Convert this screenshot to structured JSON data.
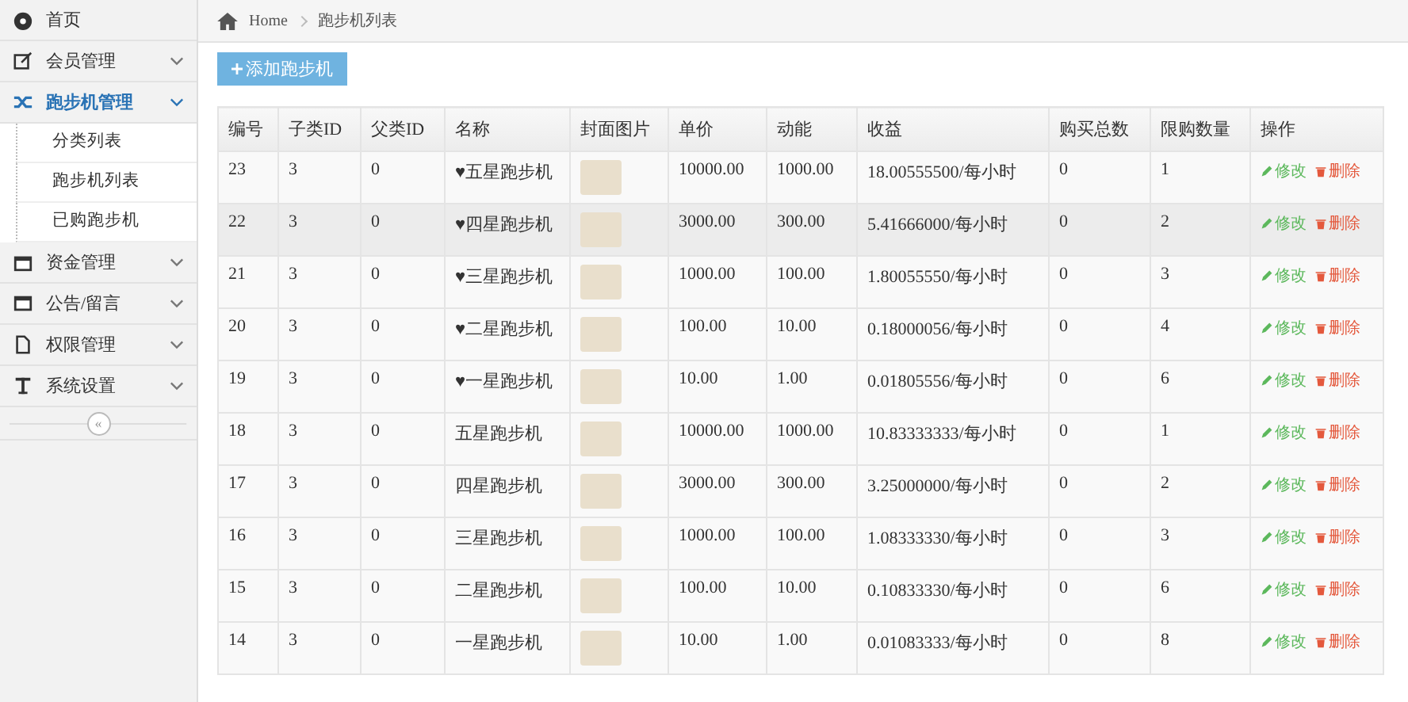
{
  "sidebar": {
    "items": [
      {
        "label": "首页",
        "kind": "link",
        "selected": false
      },
      {
        "label": "会员管理",
        "kind": "group",
        "expanded": false,
        "selected": false
      },
      {
        "label": "跑步机管理",
        "kind": "group",
        "expanded": true,
        "selected": true,
        "children": [
          {
            "label": "分类列表"
          },
          {
            "label": "跑步机列表"
          },
          {
            "label": "已购跑步机"
          }
        ]
      },
      {
        "label": "资金管理",
        "kind": "group",
        "expanded": false,
        "selected": false
      },
      {
        "label": "公告/留言",
        "kind": "group",
        "expanded": false,
        "selected": false
      },
      {
        "label": "权限管理",
        "kind": "group",
        "expanded": false,
        "selected": false
      },
      {
        "label": "系统设置",
        "kind": "group",
        "expanded": false,
        "selected": false
      }
    ],
    "collapse": "«"
  },
  "breadcrumb": [
    "Home",
    "跑步机列表"
  ],
  "add_button": "添加跑步机",
  "table": {
    "columns": [
      "编号",
      "子类ID",
      "父类ID",
      "名称",
      "封面图片",
      "单价",
      "动能",
      "收益",
      "购买总数",
      "限购数量",
      "操作"
    ],
    "rows": [
      {
        "cells": [
          "23",
          "3",
          "0",
          "♥五星跑步机",
          "",
          "10000.00",
          "1000.00",
          "18.00555500/每小时",
          "0",
          "1"
        ],
        "actions": [
          "修改",
          "删除"
        ],
        "selected": false
      },
      {
        "cells": [
          "22",
          "3",
          "0",
          "♥四星跑步机",
          "",
          "3000.00",
          "300.00",
          "5.41666000/每小时",
          "0",
          "2"
        ],
        "actions": [
          "修改",
          "删除"
        ],
        "selected": true
      },
      {
        "cells": [
          "21",
          "3",
          "0",
          "♥三星跑步机",
          "",
          "1000.00",
          "100.00",
          "1.80055550/每小时",
          "0",
          "3"
        ],
        "actions": [
          "修改",
          "删除"
        ],
        "selected": false
      },
      {
        "cells": [
          "20",
          "3",
          "0",
          "♥二星跑步机",
          "",
          "100.00",
          "10.00",
          "0.18000056/每小时",
          "0",
          "4"
        ],
        "actions": [
          "修改",
          "删除"
        ],
        "selected": false
      },
      {
        "cells": [
          "19",
          "3",
          "0",
          "♥一星跑步机",
          "",
          "10.00",
          "1.00",
          "0.01805556/每小时",
          "0",
          "6"
        ],
        "actions": [
          "修改",
          "删除"
        ],
        "selected": false
      },
      {
        "cells": [
          "18",
          "3",
          "0",
          "五星跑步机",
          "",
          "10000.00",
          "1000.00",
          "10.83333333/每小时",
          "0",
          "1"
        ],
        "actions": [
          "修改",
          "删除"
        ],
        "selected": false
      },
      {
        "cells": [
          "17",
          "3",
          "0",
          "四星跑步机",
          "",
          "3000.00",
          "300.00",
          "3.25000000/每小时",
          "0",
          "2"
        ],
        "actions": [
          "修改",
          "删除"
        ],
        "selected": false
      },
      {
        "cells": [
          "16",
          "3",
          "0",
          "三星跑步机",
          "",
          "1000.00",
          "100.00",
          "1.08333330/每小时",
          "0",
          "3"
        ],
        "actions": [
          "修改",
          "删除"
        ],
        "selected": false
      },
      {
        "cells": [
          "15",
          "3",
          "0",
          "二星跑步机",
          "",
          "100.00",
          "10.00",
          "0.10833330/每小时",
          "0",
          "6"
        ],
        "actions": [
          "修改",
          "删除"
        ],
        "selected": false
      },
      {
        "cells": [
          "14",
          "3",
          "0",
          "一星跑步机",
          "",
          "10.00",
          "1.00",
          "0.01083333/每小时",
          "0",
          "8"
        ],
        "actions": [
          "修改",
          "删除"
        ],
        "selected": false
      }
    ]
  }
}
